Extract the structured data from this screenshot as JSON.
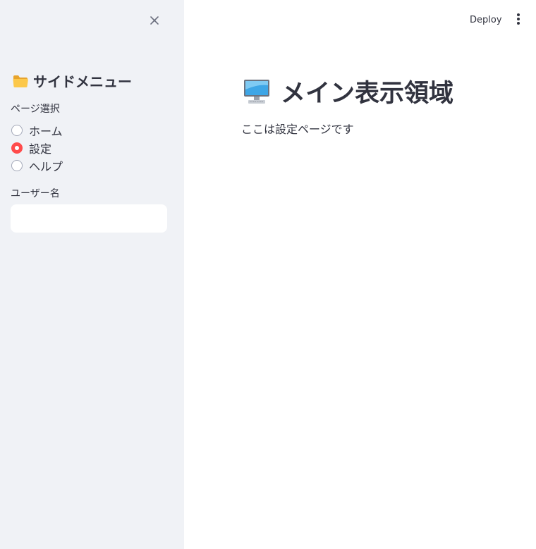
{
  "sidebar": {
    "close_icon": "close-icon",
    "title": "サイドメニュー",
    "title_icon": "folder-icon",
    "page_select": {
      "label": "ページ選択",
      "options": [
        {
          "label": "ホーム",
          "selected": false
        },
        {
          "label": "設定",
          "selected": true
        },
        {
          "label": "ヘルプ",
          "selected": false
        }
      ]
    },
    "username": {
      "label": "ユーザー名",
      "value": "",
      "placeholder": ""
    }
  },
  "header": {
    "deploy_label": "Deploy",
    "menu_icon": "more-vertical-icon"
  },
  "main": {
    "title_icon": "computer-icon",
    "title": "メイン表示領域",
    "text": "ここは設定ページです"
  },
  "colors": {
    "sidebar_bg": "#f0f2f6",
    "accent": "#ff4b4b",
    "text": "#31333f"
  }
}
